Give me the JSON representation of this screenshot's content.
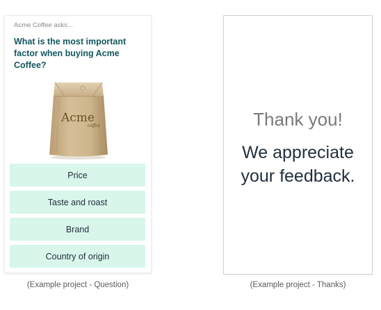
{
  "question_card": {
    "asker": "Acme Coffee asks...",
    "question": "What is the most important factor when buying Acme Coffee?",
    "product_image": {
      "brand_text": "Acme",
      "brand_subtext": "coffee",
      "bag_color": "#c9b08a"
    },
    "options": [
      {
        "label": "Price"
      },
      {
        "label": "Taste and roast"
      },
      {
        "label": "Brand"
      },
      {
        "label": "Country of origin"
      }
    ],
    "option_color": "#d8f6ea",
    "question_color": "#13575f"
  },
  "thanks_card": {
    "title": "Thank you!",
    "message": "We appreciate your feedback."
  },
  "captions": {
    "question": "(Example project - Question)",
    "thanks": "(Example project - Thanks)"
  }
}
